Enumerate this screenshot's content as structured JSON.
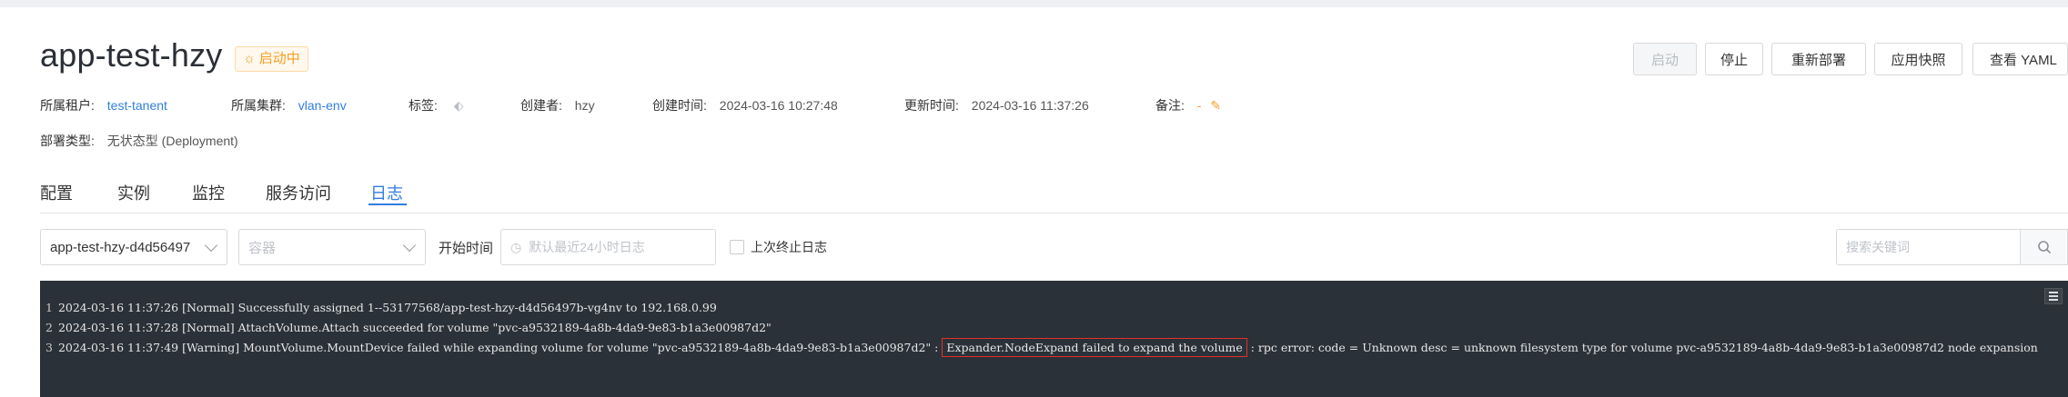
{
  "app": {
    "title": "app-test-hzy",
    "status": "启动中"
  },
  "actions": {
    "start": "启动",
    "stop": "停止",
    "redeploy": "重新部署",
    "snapshot": "应用快照",
    "view_yaml": "查看 YAML"
  },
  "meta": {
    "tenant_label": "所属租户:",
    "tenant_value": "test-tanent",
    "cluster_label": "所属集群:",
    "cluster_value": "vlan-env",
    "tags_label": "标签:",
    "creator_label": "创建者:",
    "creator_value": "hzy",
    "created_label": "创建时间:",
    "created_value": "2024-03-16 10:27:48",
    "updated_label": "更新时间:",
    "updated_value": "2024-03-16 11:37:26",
    "remark_label": "备注:",
    "remark_value": "-",
    "type_label": "部署类型:",
    "type_value": "无状态型 (Deployment)"
  },
  "tabs": [
    "配置",
    "实例",
    "监控",
    "服务访问",
    "日志"
  ],
  "active_tab": "日志",
  "filters": {
    "pod_select": "app-test-hzy-d4d56497",
    "container_placeholder": "容器",
    "start_time_label": "开始时间",
    "time_placeholder": "默认最近24小时日志",
    "last_terminated_label": "上次终止日志",
    "search_placeholder": "搜索关键词"
  },
  "log": {
    "lines": [
      {
        "num": "1",
        "text": "2024-03-16 11:37:26 [Normal] Successfully assigned 1--53177568/app-test-hzy-d4d56497b-vg4nv to 192.168.0.99"
      },
      {
        "num": "2",
        "text": "2024-03-16 11:37:28 [Normal] AttachVolume.Attach succeeded for volume \"pvc-a9532189-4a8b-4da9-9e83-b1a3e00987d2\""
      },
      {
        "num": "3",
        "pre": "2024-03-16 11:37:49 [Warning] MountVolume.MountDevice failed while expanding volume for volume \"pvc-a9532189-4a8b-4da9-9e83-b1a3e00987d2\" :",
        "highlight": "Expander.NodeExpand failed to expand the volume",
        "post": ": rpc error: code = Unknown desc = unknown filesystem type for volume pvc-a9532189-4a8b-4da9-9e83-b1a3e00987d2 node expansion"
      }
    ]
  },
  "colors": {
    "accent": "#2f7ee0",
    "warning": "#f5a023",
    "log_bg": "#2b3138",
    "highlight_border": "#e0312a"
  }
}
